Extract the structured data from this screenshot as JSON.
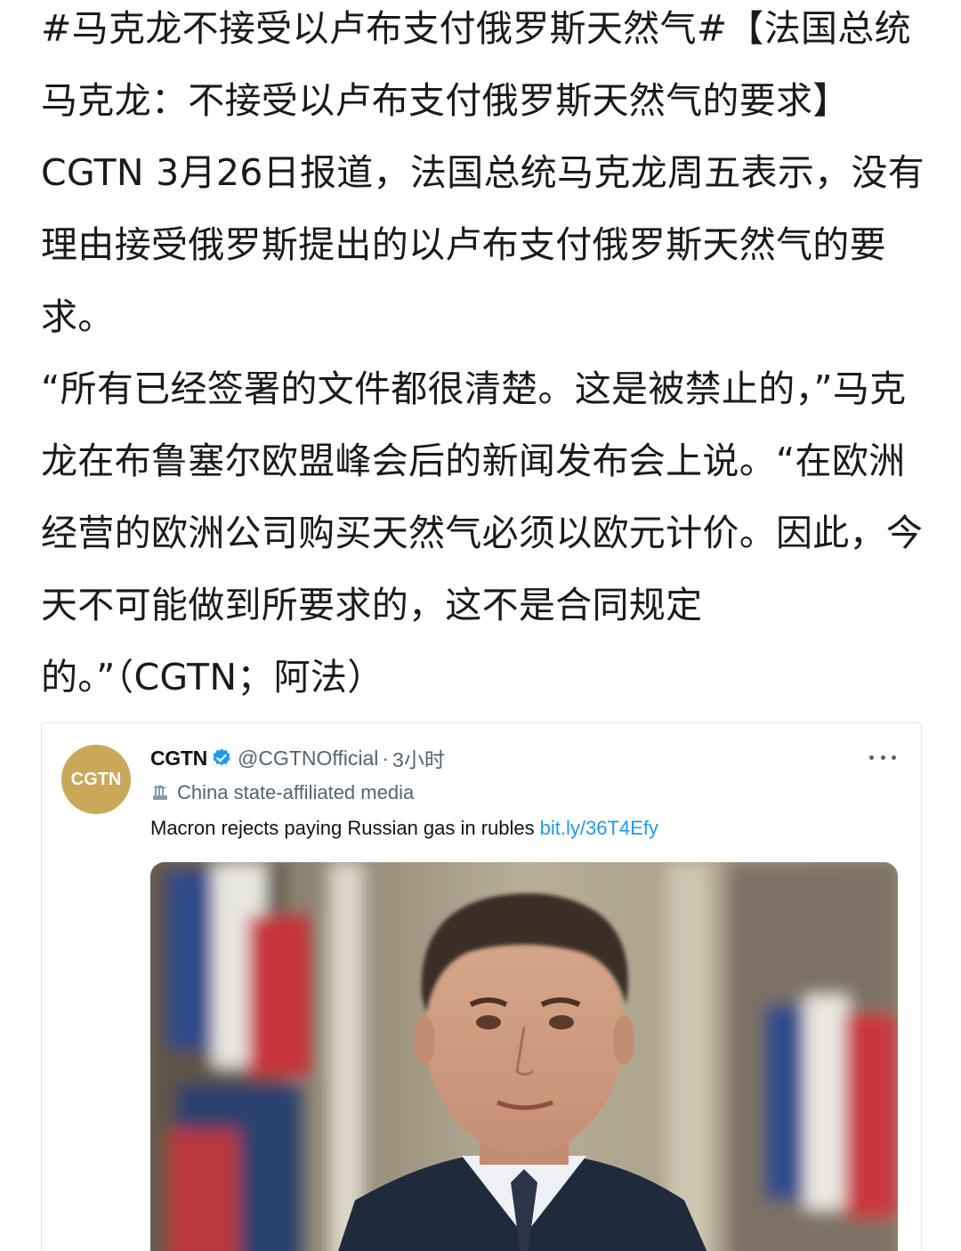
{
  "post": {
    "paragraph1": "#马克龙不接受以卢布支付俄罗斯天然气#【法国总统马克龙：不接受以卢布支付俄罗斯天然气的要求】CGTN 3月26日报道，法国总统马克龙周五表示，没有理由接受俄罗斯提出的以卢布支付俄罗斯天然气的要求。",
    "paragraph2": "“所有已经签署的文件都很清楚。这是被禁止的，”马克龙在布鲁塞尔欧盟峰会后的新闻发布会上说。“在欧洲经营的欧洲公司购买天然气必须以欧元计价。因此，今天不可能做到所要求的，这不是合同规定的。”（CGTN；阿法）"
  },
  "tweet": {
    "avatar_text": "CGTN",
    "name": "CGTN",
    "handle": "@CGTNOfficial",
    "separator": "·",
    "time": "3小时",
    "affiliation": "China state-affiliated media",
    "text": "Macron rejects paying Russian gas in rubles",
    "link": "bit.ly/36T4Efy",
    "media_icon": "photo-of-macron"
  },
  "colors": {
    "link": "#1d9bf0",
    "verified": "#1d9bf0",
    "avatar_bg": "#c9a85a",
    "secondary_text": "#536471"
  }
}
